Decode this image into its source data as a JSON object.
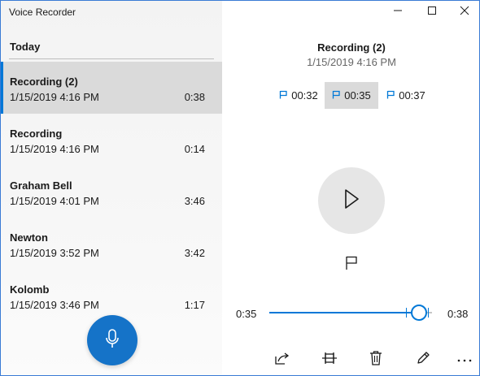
{
  "app": {
    "title": "Voice Recorder"
  },
  "list": {
    "group_header": "Today",
    "items": [
      {
        "name": "Recording (2)",
        "date": "1/15/2019 4:16 PM",
        "duration": "0:38",
        "selected": true
      },
      {
        "name": "Recording",
        "date": "1/15/2019 4:16 PM",
        "duration": "0:14",
        "selected": false
      },
      {
        "name": "Graham Bell",
        "date": "1/15/2019 4:01 PM",
        "duration": "3:46",
        "selected": false
      },
      {
        "name": "Newton",
        "date": "1/15/2019 3:52 PM",
        "duration": "3:42",
        "selected": false
      },
      {
        "name": "Kolomb",
        "date": "1/15/2019 3:46 PM",
        "duration": "1:17",
        "selected": false
      }
    ]
  },
  "detail": {
    "title": "Recording (2)",
    "date": "1/15/2019 4:16 PM",
    "markers": [
      {
        "time": "00:32",
        "selected": false
      },
      {
        "time": "00:35",
        "selected": true
      },
      {
        "time": "00:37",
        "selected": false
      }
    ],
    "playback": {
      "current_time": "0:35",
      "total_time": "0:38",
      "progress_fraction": 0.92,
      "marker_fractions": [
        0.842,
        0.974
      ]
    }
  },
  "icons": {
    "minimize": "minimize-icon",
    "maximize": "maximize-icon",
    "close": "close-icon",
    "record": "microphone-icon",
    "play": "play-icon",
    "flag": "flag-icon",
    "share": "share-icon",
    "trim": "trim-icon",
    "delete": "delete-icon",
    "rename": "pencil-icon",
    "more": "more-icon"
  },
  "colors": {
    "accent": "#0078d7",
    "record_button": "#1573c8",
    "selected_background": "#dadada"
  }
}
